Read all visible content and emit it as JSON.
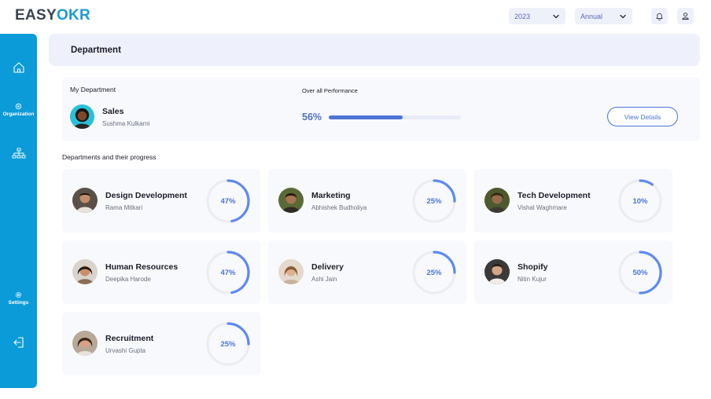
{
  "app": {
    "logo_prefix": "EASY",
    "logo_accent": "OKR",
    "accent_color": "#0c9bd9"
  },
  "topbar": {
    "year": "2023",
    "period": "Annual",
    "icons": [
      "chevron-down-icon",
      "bell-icon",
      "user-icon"
    ]
  },
  "sidebar": {
    "items": [
      {
        "icon": "home-icon",
        "label": ""
      },
      {
        "icon": "organization-icon",
        "label": "Organization"
      },
      {
        "icon": "hierarchy-icon",
        "label": ""
      },
      {
        "icon": "settings-icon",
        "label": "Settings"
      },
      {
        "icon": "logout-icon",
        "label": ""
      }
    ]
  },
  "page": {
    "title": "Department"
  },
  "my_department": {
    "label": "My Department",
    "name": "Sales",
    "person": "Sushma Kulkarni",
    "performance_label": "Over all Performance",
    "performance_text": "56%",
    "performance_value": 56,
    "button_label": "View Details"
  },
  "departments": {
    "title": "Departments and their progress",
    "items": [
      {
        "name": "Design Development",
        "person": "Rama Mitkari",
        "progress_text": "47%",
        "progress": 47
      },
      {
        "name": "Marketing",
        "person": "Abhishek Budholiya",
        "progress_text": "25%",
        "progress": 25
      },
      {
        "name": "Tech Development",
        "person": "Vishal Waghmare",
        "progress_text": "10%",
        "progress": 10
      },
      {
        "name": "Human Resources",
        "person": "Deepika Harode",
        "progress_text": "47%",
        "progress": 47
      },
      {
        "name": "Delivery",
        "person": "Ashi Jain",
        "progress_text": "25%",
        "progress": 25
      },
      {
        "name": "Shopify",
        "person": "Nitin Kujur",
        "progress_text": "50%",
        "progress": 50
      },
      {
        "name": "Recruitment",
        "person": "Urvashi Gupta",
        "progress_text": "25%",
        "progress": 25
      }
    ]
  }
}
